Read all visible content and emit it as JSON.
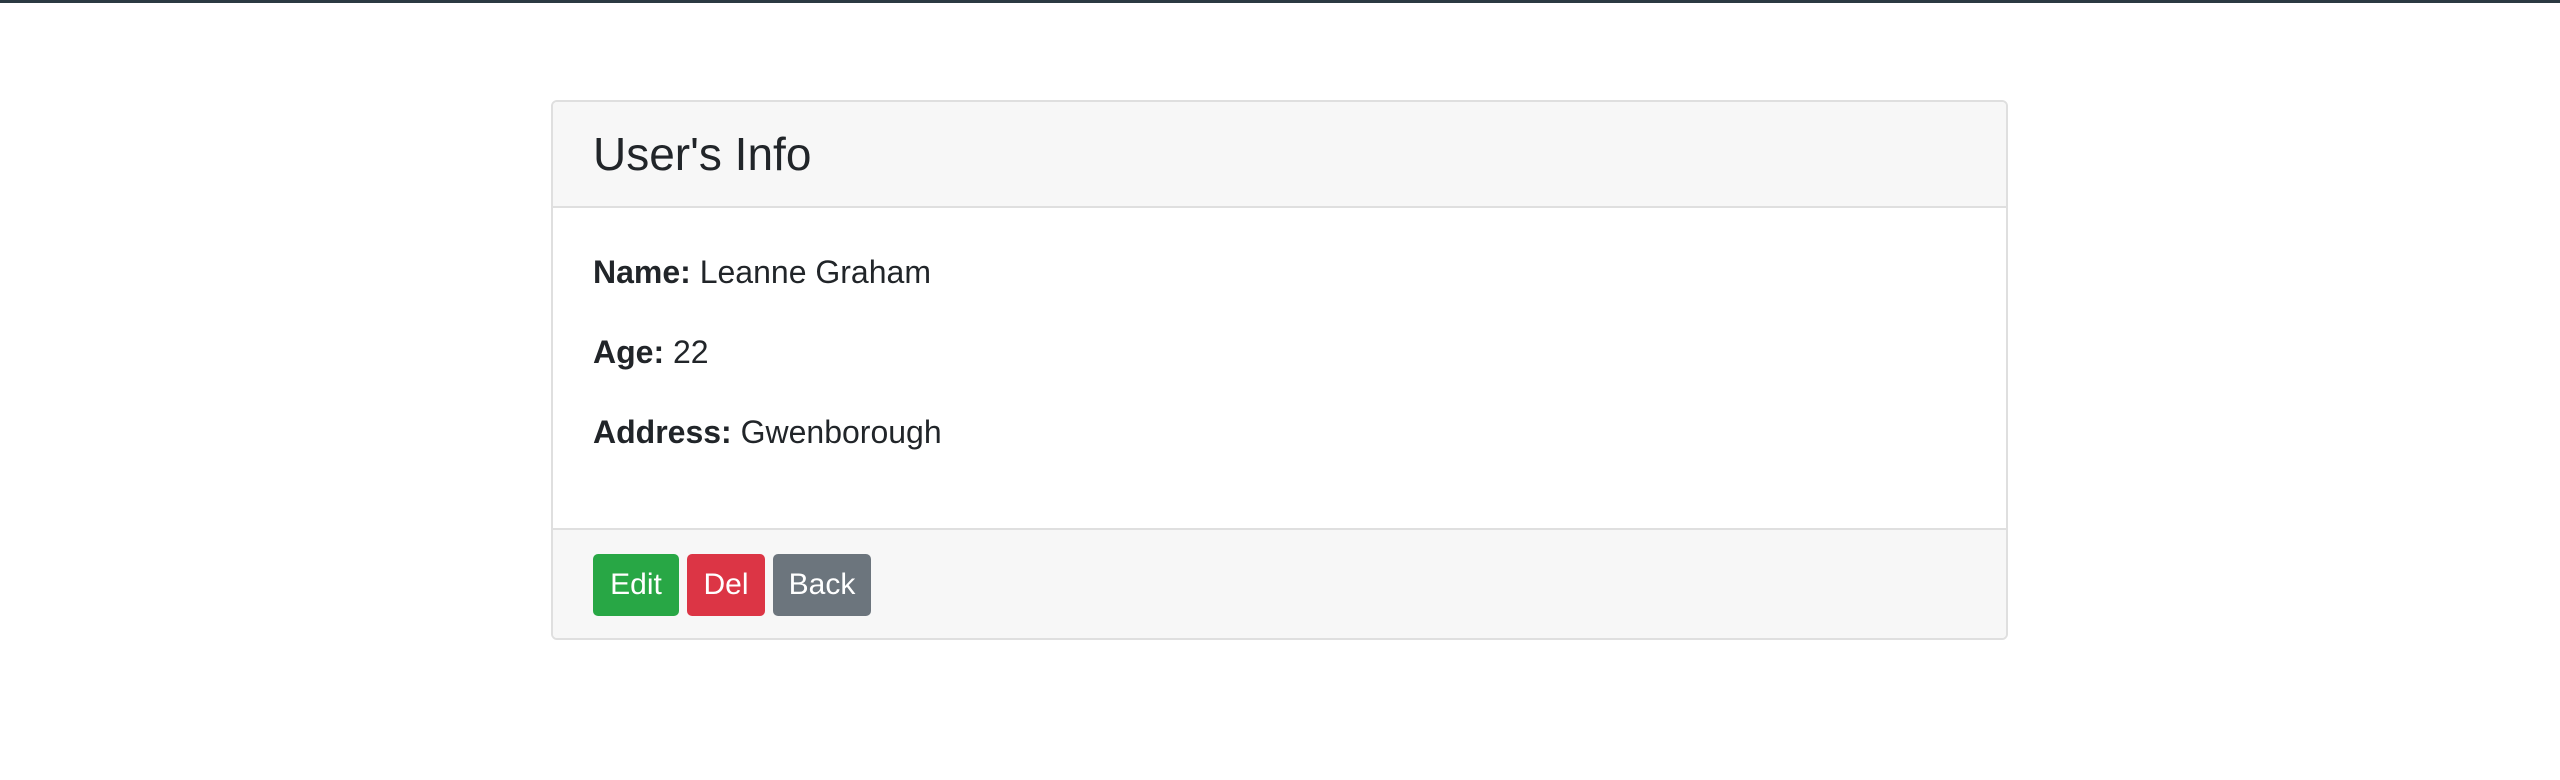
{
  "card": {
    "title": "User's Info",
    "fields": [
      {
        "label": "Name:",
        "value": "Leanne Graham"
      },
      {
        "label": "Age:",
        "value": "22"
      },
      {
        "label": "Address:",
        "value": "Gwenborough"
      }
    ]
  },
  "actions": {
    "edit_label": "Edit",
    "delete_label": "Del",
    "back_label": "Back"
  },
  "colors": {
    "top_bar": "#2b3a42",
    "edit": "#28a745",
    "delete": "#dc3545",
    "back": "#6c757d",
    "header_bg": "#f7f7f7",
    "border": "#dfdfdf"
  }
}
